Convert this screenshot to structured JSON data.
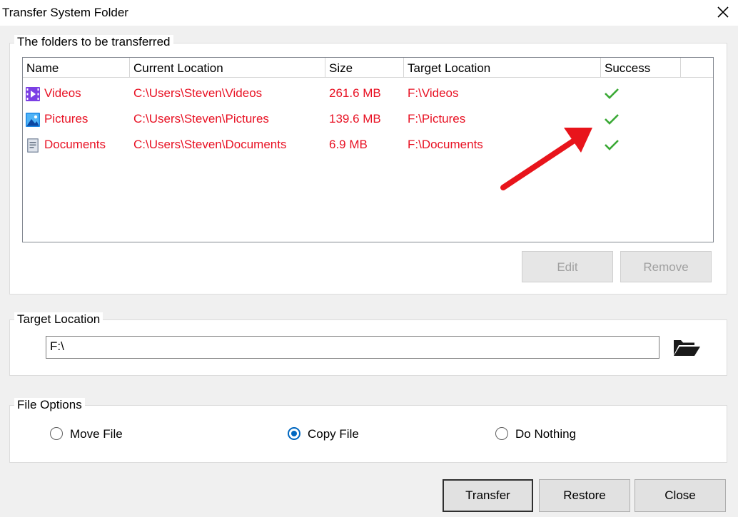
{
  "window": {
    "title": "Transfer System Folder"
  },
  "folders_group": {
    "legend": "The folders to be transferred",
    "columns": [
      "Name",
      "Current Location",
      "Size",
      "Target Location",
      "Success"
    ],
    "rows": [
      {
        "icon": "video-folder-icon",
        "name": "Videos",
        "current": "C:\\Users\\Steven\\Videos",
        "size": "261.6 MB",
        "target": "F:\\Videos",
        "success": true
      },
      {
        "icon": "picture-folder-icon",
        "name": "Pictures",
        "current": "C:\\Users\\Steven\\Pictures",
        "size": "139.6 MB",
        "target": "F:\\Pictures",
        "success": true
      },
      {
        "icon": "document-folder-icon",
        "name": "Documents",
        "current": "C:\\Users\\Steven\\Documents",
        "size": "6.9 MB",
        "target": "F:\\Documents",
        "success": true
      }
    ],
    "edit_label": "Edit",
    "remove_label": "Remove"
  },
  "target_group": {
    "legend": "Target Location",
    "value": "F:\\"
  },
  "options_group": {
    "legend": "File Options",
    "options": [
      {
        "label": "Move File",
        "selected": false
      },
      {
        "label": "Copy File",
        "selected": true
      },
      {
        "label": "Do Nothing",
        "selected": false
      }
    ]
  },
  "footer": {
    "transfer_label": "Transfer",
    "restore_label": "Restore",
    "close_label": "Close"
  },
  "colors": {
    "row_text": "#e81123",
    "check": "#3aa935",
    "annotation_arrow": "#e8141b",
    "radio_accent": "#0067c0"
  }
}
